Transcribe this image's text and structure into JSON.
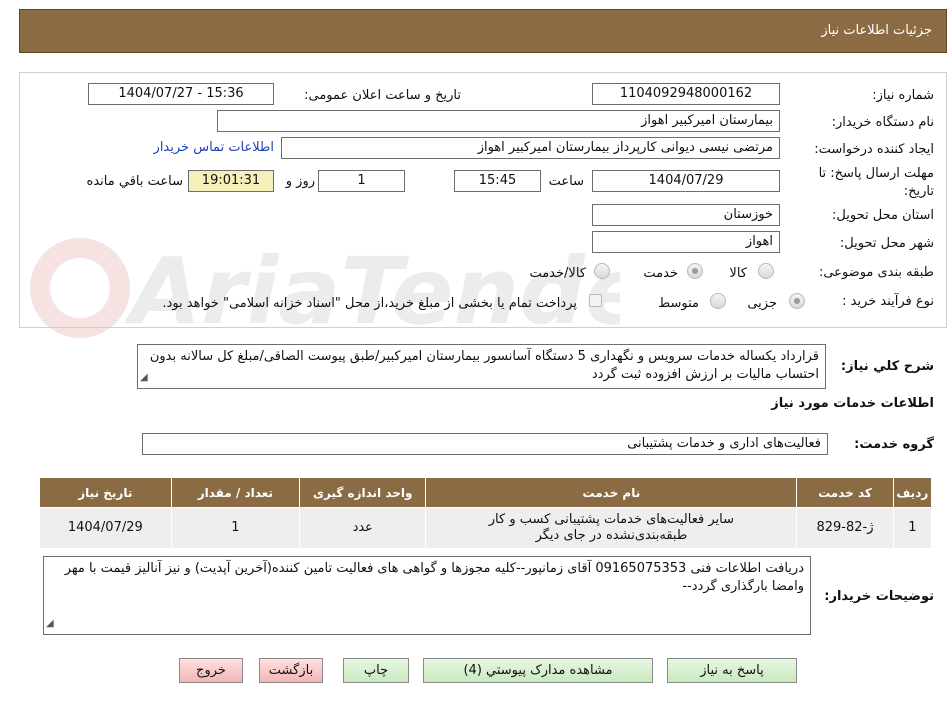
{
  "header": {
    "title": "جزئیات اطلاعات نیاز"
  },
  "labels": {
    "need_number": "شماره نیاز:",
    "announce_datetime": "تاریخ و ساعت اعلان عمومی:",
    "buyer_org": "نام دستگاه خریدار:",
    "requester": "ایجاد کننده درخواست:",
    "deadline_line1": "مهلت ارسال پاسخ: تا",
    "deadline_line2": "تاریخ:",
    "time_word": "ساعت",
    "day_and": "روز و",
    "remaining": "ساعت باقي مانده",
    "province": "استان محل تحویل:",
    "city": "شهر محل تحویل:",
    "category": "طبقه بندی موضوعی:",
    "process_type": "نوع فرآیند خرید :",
    "description": "شرح کلي نياز:",
    "services_info": "اطلاعات خدمات مورد نیاز",
    "service_group": "گروه خدمت:",
    "buyer_notes": "توضیحات خریدار:"
  },
  "values": {
    "need_number": "1104092948000162",
    "announce_datetime": "1404/07/27 - 15:36",
    "buyer_org": "بیمارستان امیرکبیر اهواز",
    "requester": "مرتضی نیسی دیوانی کارپرداز بیمارستان امیرکبیر اهواز",
    "contact_link": "اطلاعات تماس خریدار",
    "deadline_date": "1404/07/29",
    "deadline_time": "15:45",
    "days": "1",
    "remaining_time": "19:01:31",
    "province": "خوزستان",
    "city": "اهواز",
    "category_options": [
      "کالا",
      "خدمت",
      "کالا/خدمت"
    ],
    "process_options": [
      "جزیی",
      "متوسط"
    ],
    "payment_note": "پرداخت تمام یا بخشی از مبلغ خرید،از محل \"اسناد خزانه اسلامی\" خواهد بود.",
    "description": "قرارداد یکساله خدمات سرویس و نگهداری 5 دستگاه آسانسور بیمارستان امیرکبیر/طبق پیوست الصاقی/مبلغ کل سالانه بدون احتساب مالیات بر ارزش افزوده ثبت گردد",
    "service_group": "فعالیت‌های اداری و خدمات پشتیبانی",
    "buyer_notes": "دریافت اطلاعات فنی 09165075353 آقای زمانپور--کلیه مجوزها و گواهی های فعالیت  تامین کننده(آخرین آپدیت) و نیز آنالیز قیمت با مهر وامضا بارگذاری گردد--"
  },
  "table": {
    "headers": [
      "ردیف",
      "کد خدمت",
      "نام خدمت",
      "واحد اندازه گیری",
      "تعداد / مقدار",
      "تاریخ نیاز"
    ],
    "rows": [
      {
        "row": "1",
        "code": "ژ-82-829",
        "name": "سایر فعالیت‌های خدمات پشتیبانی کسب و کار طبقه‌بندی‌نشده در جای دیگر",
        "unit": "عدد",
        "qty": "1",
        "date": "1404/07/29"
      }
    ]
  },
  "buttons": {
    "reply": "پاسخ به نیاز",
    "attachments": "مشاهده مدارک پیوستي (4)",
    "print": "چاپ",
    "back": "بازگشت",
    "exit": "خروج"
  },
  "colors": {
    "brand": "#8b6b43",
    "remaining_bg": "#f5f0b9",
    "link": "#1f3fbf"
  }
}
